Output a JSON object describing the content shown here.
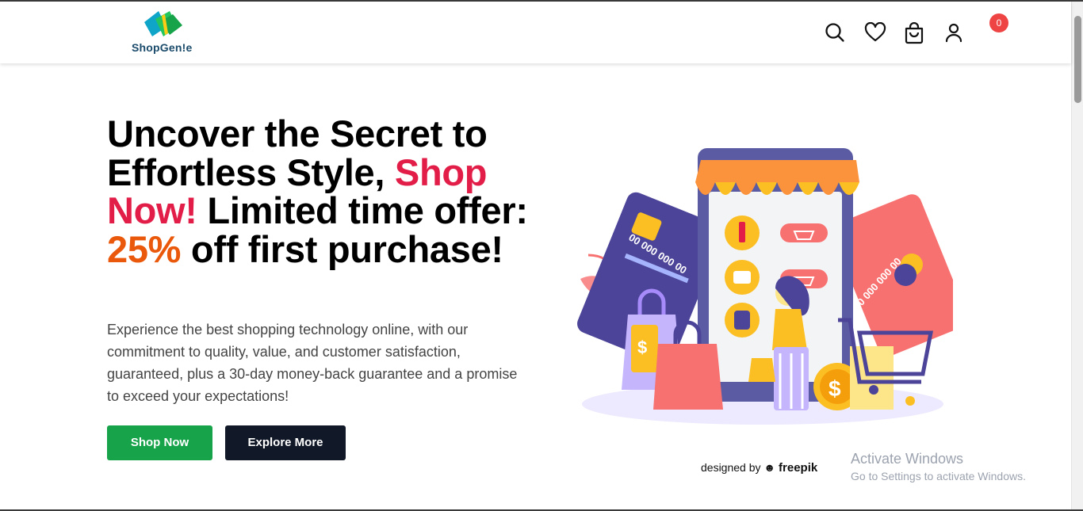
{
  "header": {
    "logo_text": "ShopGen!e",
    "cart_count": "0",
    "icons": [
      "search-icon",
      "heart-icon",
      "shopping-bag-icon",
      "user-icon"
    ]
  },
  "hero": {
    "title_part1": "Uncover the Secret to Effortless Style, ",
    "title_red": "Shop Now!",
    "title_part2": " Limited time offer: ",
    "title_orange": "25%",
    "title_part3": " off first purchase!",
    "subtitle": "Experience the best shopping technology online, with our commitment to quality, value, and customer satisfaction, guaranteed, plus a 30-day money-back guarantee and a promise to exceed your expectations!",
    "primary_button": "Shop Now",
    "secondary_button": "Explore More"
  },
  "illustration": {
    "card_number": "00 000 000 00",
    "credit_prefix": "designed by",
    "credit_brand": "freepik"
  },
  "os_overlay": {
    "line1": "Activate Windows",
    "line2": "Go to Settings to activate Windows."
  },
  "colors": {
    "accent_red": "#e11d48",
    "accent_orange": "#ea580c",
    "primary_green": "#16a34a",
    "dark_button": "#111827",
    "badge_red": "#ef4444"
  }
}
